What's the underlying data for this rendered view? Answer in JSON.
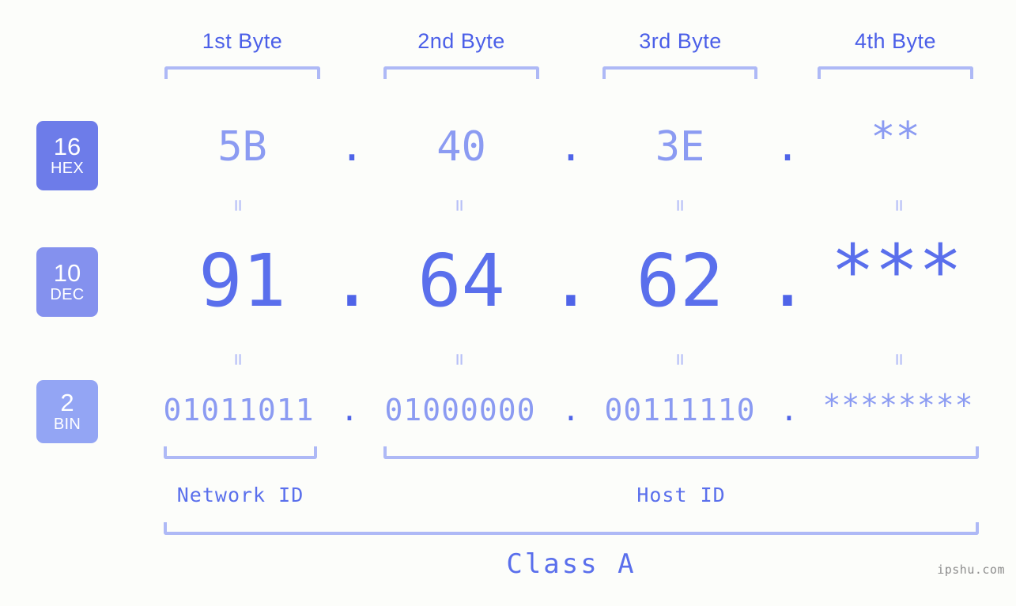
{
  "background_color": "#fcfdfa",
  "accent_colors": {
    "label_blue": "#4b5fe8",
    "bracket_blue": "#aeb9f6",
    "value_light": "#8b9bf2",
    "value_strong": "#5a6fec",
    "dot_blue": "#4f64e8",
    "badge_hex": "#6d7ce9",
    "badge_dec": "#8491ee",
    "badge_bin": "#93a5f4",
    "watermark_gray": "#8c8c8c"
  },
  "byte_headers": [
    {
      "label": "1st Byte"
    },
    {
      "label": "2nd Byte"
    },
    {
      "label": "3rd Byte"
    },
    {
      "label": "4th Byte"
    }
  ],
  "bases": [
    {
      "number": "16",
      "name": "HEX"
    },
    {
      "number": "10",
      "name": "DEC"
    },
    {
      "number": "2",
      "name": "BIN"
    }
  ],
  "rows": {
    "hex": {
      "base_number": "16",
      "base_name": "HEX",
      "values": [
        "5B",
        "40",
        "3E",
        "**"
      ],
      "separator": "."
    },
    "dec": {
      "base_number": "10",
      "base_name": "DEC",
      "values": [
        "91",
        "64",
        "62",
        "***"
      ],
      "separator": "."
    },
    "bin": {
      "base_number": "2",
      "base_name": "BIN",
      "values": [
        "01011011",
        "01000000",
        "00111110",
        "********"
      ],
      "separator": "."
    }
  },
  "equals_symbol": "=",
  "segments": {
    "network_id": "Network ID",
    "host_id": "Host ID",
    "class": "Class A"
  },
  "watermark": "ipshu.com"
}
